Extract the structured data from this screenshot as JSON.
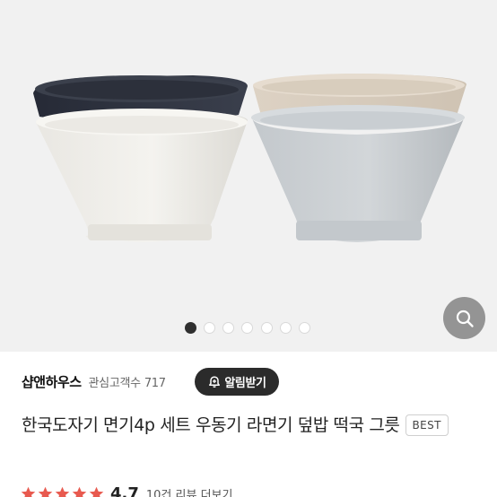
{
  "gallery": {
    "image_description": "four stacked ceramic bowls (navy, white, beige, gray)",
    "slide_count": 7,
    "active_slide": 1,
    "zoom_icon": "search-icon"
  },
  "store": {
    "name": "샵앤하우스",
    "followers_label": "관심고객수",
    "followers_count": "717",
    "alarm_button_label": "알림받기",
    "alarm_icon": "bell-plus-icon"
  },
  "product": {
    "title": "한국도자기 면기4p 세트 우동기 라면기 덮밥 떡국 그릇",
    "badge": "BEST"
  },
  "rating": {
    "score": "4.7",
    "stars_filled": 5,
    "review_count": "10건 리뷰 더보기",
    "more_label": ""
  },
  "colors": {
    "star": "#e85a4f",
    "button_bg": "#2b2b2b",
    "gallery_bg": "#f1f1f1"
  }
}
